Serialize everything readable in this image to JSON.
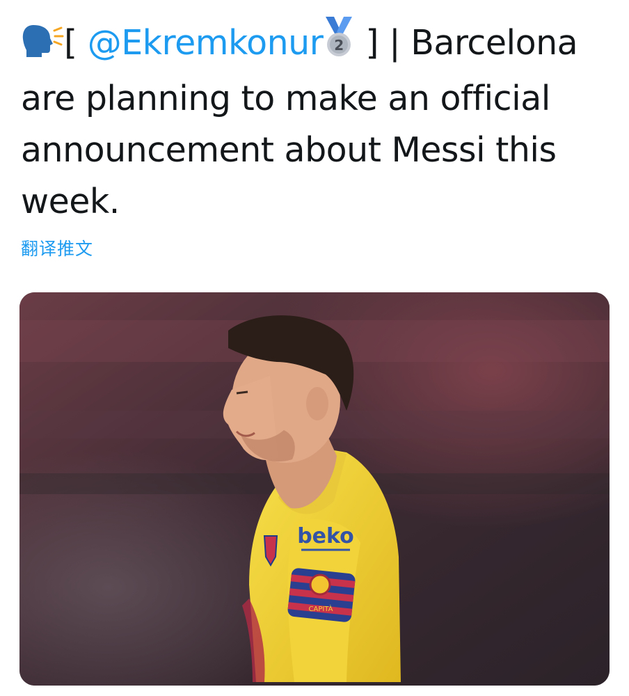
{
  "tweet": {
    "prefix_bracket": "[",
    "mention": "@Ekremkonur",
    "suffix": " ] | Barcelona are planning to make an official announcement about Messi this week.",
    "translate_label": "翻译推文",
    "speaking_emoji": "speaking-head-icon",
    "medal_emoji": "second-place-medal-icon",
    "medal_number": "2"
  },
  "media": {
    "sponsor_text": "beko",
    "armband_text": "CAPITÀ",
    "colors": {
      "shirt": "#f2d43a",
      "background": "#4a2c36",
      "link": "#1d9bf0"
    }
  }
}
